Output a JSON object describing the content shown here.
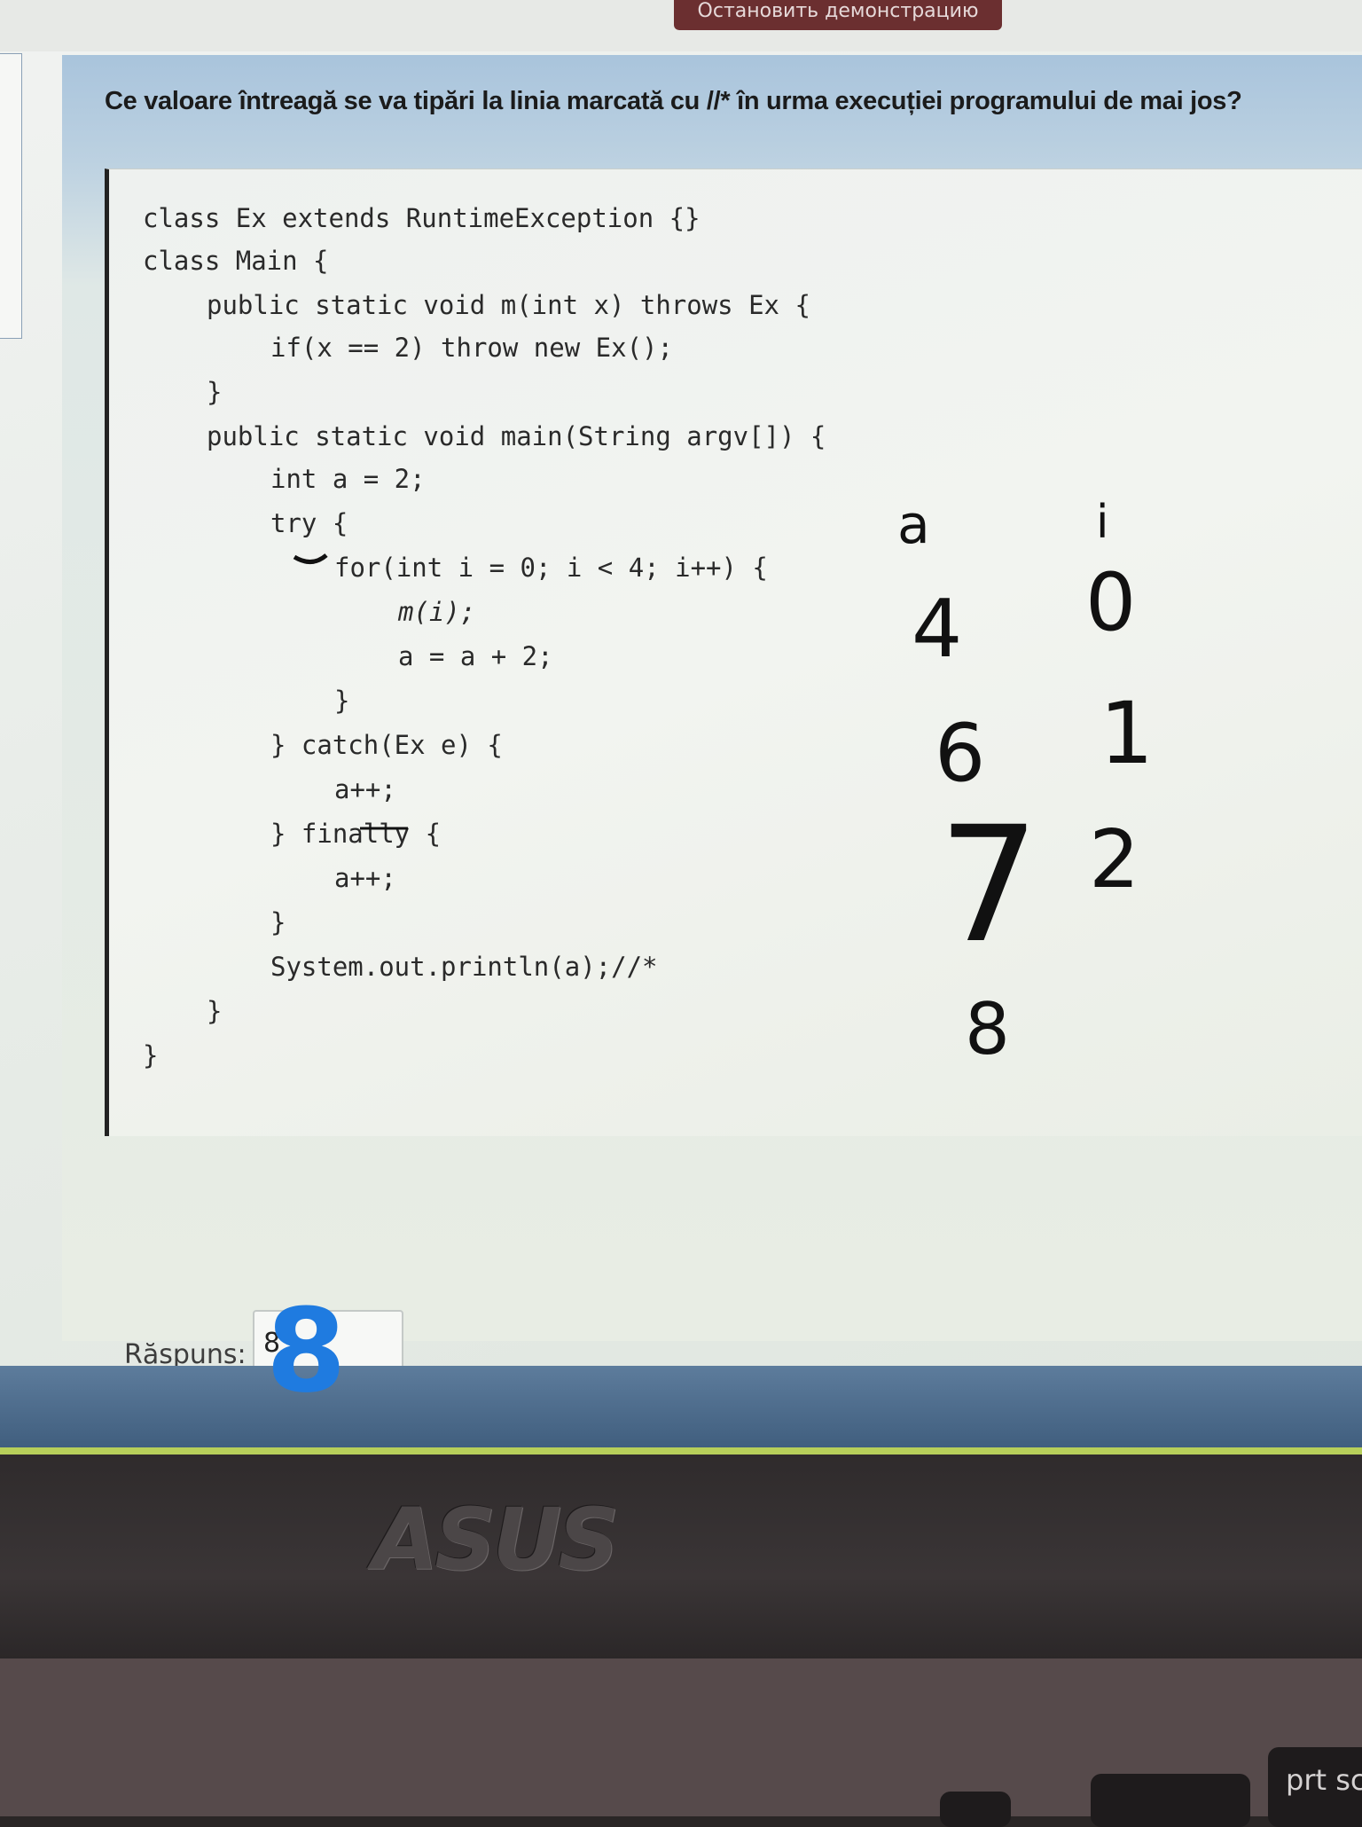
{
  "share_bar": {
    "label": "Остановить демонстрацию"
  },
  "question": {
    "text": "Ce valoare întreagă se va tipări la linia marcată cu //* în urma execuției programului de mai jos?"
  },
  "code_lines": [
    "class Ex extends RuntimeException {}",
    "class Main {",
    "public static void m(int x) throws Ex {",
    "if(x == 2) throw new Ex();",
    "}",
    "public static void main(String argv[]) {",
    "int a = 2;",
    "try {",
    "for(int i = 0; i < 4; i++) {",
    "m(i);",
    "a = a + 2;",
    "}",
    "} catch(Ex e) {",
    "a++;",
    "} finally {",
    "a++;",
    "}",
    "System.out.println(a);//*",
    "}",
    "}"
  ],
  "answer": {
    "label": "Răspuns:",
    "value": "8"
  },
  "handwritten_notes": {
    "column_a": [
      "a",
      "4",
      "6",
      "7",
      "8"
    ],
    "column_i": [
      "i",
      "0",
      "1",
      "2"
    ]
  },
  "laptop": {
    "brand": "ASUS",
    "key_label": "prt sc"
  },
  "colors": {
    "ink_blue": "#1f7be0",
    "frame": "#222222",
    "bezel_accent": "#b7cf5a"
  }
}
